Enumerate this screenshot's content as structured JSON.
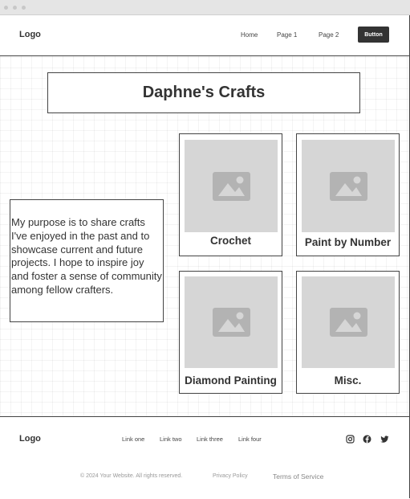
{
  "header": {
    "logo": "Logo",
    "nav": [
      "Home",
      "Page 1",
      "Page 2"
    ],
    "button": "Button"
  },
  "hero": {
    "title": "Daphne's Crafts",
    "description": "My purpose is to share crafts I've enjoyed in the past and to showcase current and future projects. I hope to inspire joy and foster a sense of community among fellow crafters."
  },
  "cards": [
    {
      "label": "Crochet",
      "icon": "image-placeholder-icon"
    },
    {
      "label": "Paint by Number",
      "icon": "image-placeholder-icon"
    },
    {
      "label": "Diamond Painting",
      "icon": "image-placeholder-icon"
    },
    {
      "label": "Misc.",
      "icon": "image-placeholder-icon"
    }
  ],
  "footer": {
    "logo": "Logo",
    "links": [
      "Link one",
      "Link two",
      "Link three",
      "Link four"
    ],
    "social": [
      "instagram-icon",
      "facebook-icon",
      "twitter-icon"
    ],
    "copyright": "© 2024 Your Website. All rights reserved.",
    "privacy": "Privacy Policy",
    "terms": "Terms of Service"
  },
  "colors": {
    "dark": "#333333",
    "placeholder": "#d6d6d6",
    "placeholder_icon": "#b3b3b3",
    "border": "#444444"
  }
}
